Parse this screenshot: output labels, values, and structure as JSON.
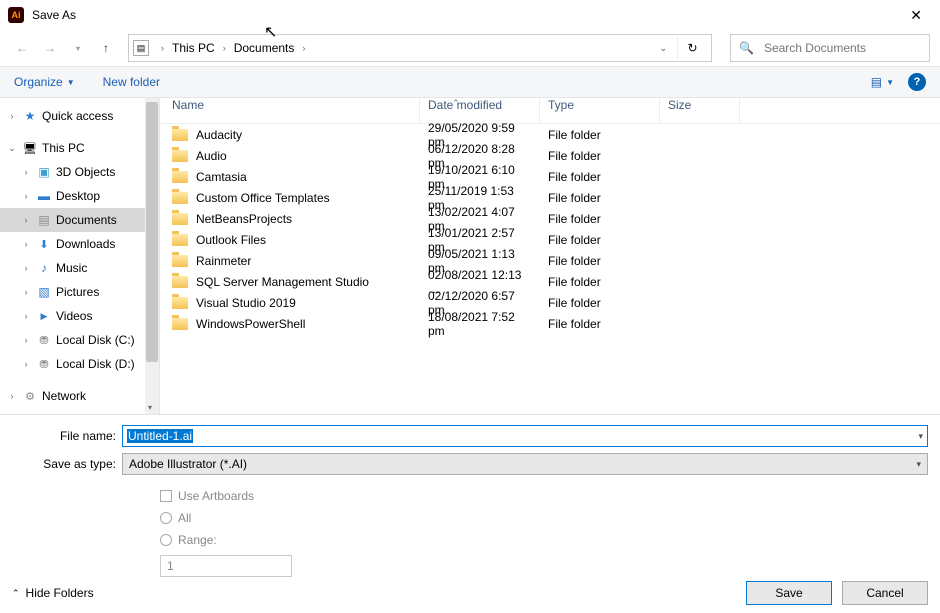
{
  "window": {
    "title": "Save As"
  },
  "breadcrumb": {
    "seg1": "This PC",
    "seg2": "Documents"
  },
  "search": {
    "placeholder": "Search Documents"
  },
  "toolbar": {
    "organize": "Organize",
    "new_folder": "New folder"
  },
  "tree": {
    "quick_access": "Quick access",
    "this_pc": "This PC",
    "objects3d": "3D Objects",
    "desktop": "Desktop",
    "documents": "Documents",
    "downloads": "Downloads",
    "music": "Music",
    "pictures": "Pictures",
    "videos": "Videos",
    "localc": "Local Disk (C:)",
    "locald": "Local Disk (D:)",
    "network": "Network"
  },
  "columns": {
    "name": "Name",
    "date": "Date modified",
    "type": "Type",
    "size": "Size"
  },
  "rows": [
    {
      "name": "Audacity",
      "date": "29/05/2020 9:59 pm",
      "type": "File folder"
    },
    {
      "name": "Audio",
      "date": "06/12/2020 8:28 pm",
      "type": "File folder"
    },
    {
      "name": "Camtasia",
      "date": "19/10/2021 6:10 pm",
      "type": "File folder"
    },
    {
      "name": "Custom Office Templates",
      "date": "25/11/2019 1:53 pm",
      "type": "File folder"
    },
    {
      "name": "NetBeansProjects",
      "date": "13/02/2021 4:07 pm",
      "type": "File folder"
    },
    {
      "name": "Outlook Files",
      "date": "13/01/2021 2:57 pm",
      "type": "File folder"
    },
    {
      "name": "Rainmeter",
      "date": "09/05/2021 1:13 pm",
      "type": "File folder"
    },
    {
      "name": "SQL Server Management Studio",
      "date": "02/08/2021 12:13 …",
      "type": "File folder"
    },
    {
      "name": "Visual Studio 2019",
      "date": "02/12/2020 6:57 pm",
      "type": "File folder"
    },
    {
      "name": "WindowsPowerShell",
      "date": "18/08/2021 7:52 pm",
      "type": "File folder"
    }
  ],
  "form": {
    "filename_label": "File name:",
    "filename_value": "Untitled-1.ai",
    "type_label": "Save as type:",
    "type_value": "Adobe Illustrator (*.AI)",
    "use_artboards": "Use Artboards",
    "all": "All",
    "range": "Range:",
    "range_value": "1"
  },
  "footer": {
    "hide_folders": "Hide Folders",
    "save": "Save",
    "cancel": "Cancel"
  }
}
